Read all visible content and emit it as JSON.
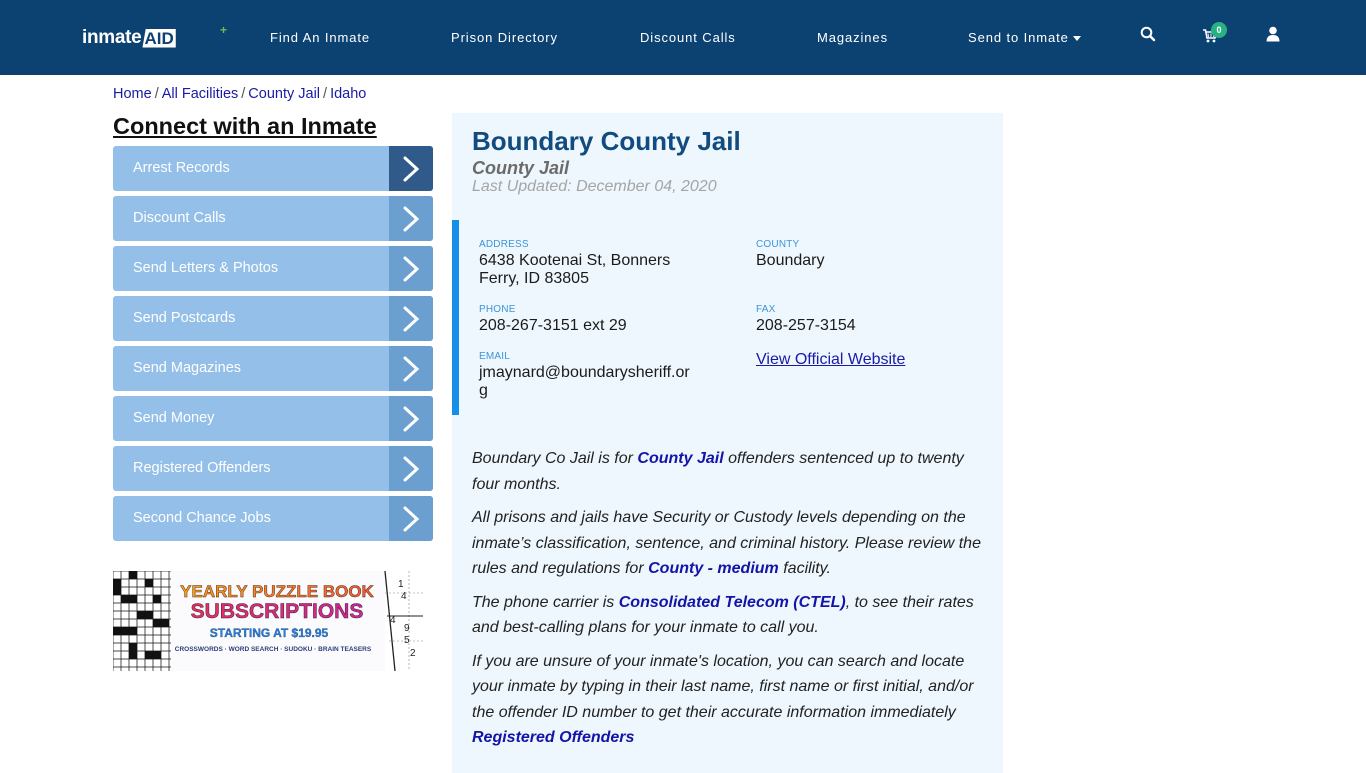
{
  "header": {
    "logo_left": "inmate",
    "logo_right": "AID",
    "logo_plus": "+",
    "nav": [
      {
        "label": "Find An Inmate"
      },
      {
        "label": "Prison Directory"
      },
      {
        "label": "Discount Calls"
      },
      {
        "label": "Magazines"
      },
      {
        "label": "Send to Inmate",
        "has_dropdown": true
      }
    ],
    "icons": [
      "search-icon",
      "cart-icon",
      "user-icon"
    ],
    "cart_count": "0",
    "colors": {
      "background": "#0c4272",
      "badge": "#26b283"
    }
  },
  "breadcrumb": [
    {
      "label": "Home"
    },
    {
      "label": "All Facilities"
    },
    {
      "label": "County Jail"
    },
    {
      "label": "Idaho"
    }
  ],
  "breadcrumb_separator": "/",
  "sidebar": {
    "title": "Connect with an Inmate",
    "items": [
      {
        "label": "Arrest Records",
        "active": true
      },
      {
        "label": "Discount Calls"
      },
      {
        "label": "Send Letters & Photos"
      },
      {
        "label": "Send Postcards"
      },
      {
        "label": "Send Magazines"
      },
      {
        "label": "Send Money"
      },
      {
        "label": "Registered Offenders"
      },
      {
        "label": "Second Chance Jobs"
      }
    ],
    "ad": {
      "line1": "YEARLY PUZZLE BOOK",
      "line2": "SUBSCRIPTIONS",
      "line3": "STARTING AT $19.95",
      "line4": "CROSSWORDS · WORD SEARCH · SUDOKU · BRAIN TEASERS",
      "sudoku_digits": [
        "1",
        "4",
        "4",
        "9",
        "5",
        "2"
      ]
    }
  },
  "facility": {
    "name": "Boundary County Jail",
    "type": "County Jail",
    "last_updated": "Last Updated: December 04, 2020",
    "fields": {
      "address": {
        "label": "ADDRESS",
        "value": "6438 Kootenai St, Bonners Ferry, ID 83805"
      },
      "county": {
        "label": "COUNTY",
        "value": "Boundary"
      },
      "phone": {
        "label": "PHONE",
        "value": "208-267-3151 ext 29"
      },
      "fax": {
        "label": "FAX",
        "value": "208-257-3154"
      },
      "email": {
        "label": "EMAIL",
        "value": "jmaynard@boundarysheriff.org"
      }
    },
    "website_link": "View Official Website",
    "description": {
      "p1": {
        "pre": "Boundary Co Jail is for ",
        "link": "County Jail",
        "post": " offenders sentenced up to twenty four months."
      },
      "p2": {
        "pre": "All prisons and jails have Security or Custody levels depending on the inmate’s classification, sentence, and criminal history. Please review the rules and regulations for ",
        "link": "County - medium",
        "post": " facility."
      },
      "p3": {
        "pre": "The phone carrier is ",
        "link": "Consolidated Telecom (CTEL)",
        "post": ", to see their rates and best-calling plans for your inmate to call you."
      },
      "p4": {
        "pre": "If you are unsure of your inmate's location, you can search and locate your inmate by typing in their last name, first name or first initial, and/or the offender ID number to get their accurate information immediately",
        "link": "Registered Offenders"
      }
    }
  }
}
